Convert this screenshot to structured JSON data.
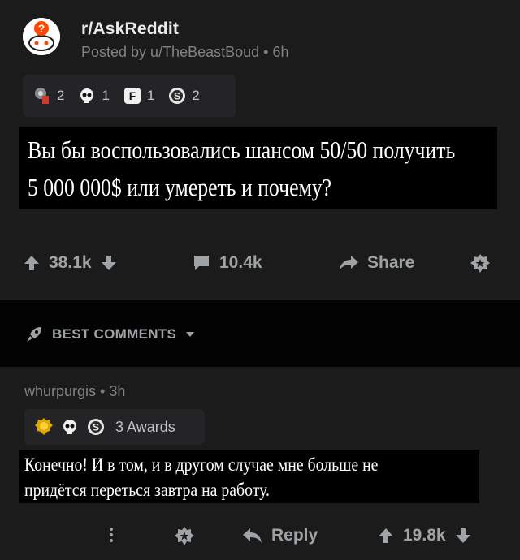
{
  "post": {
    "subreddit": "r/AskReddit",
    "meta": "Posted by u/TheBeastBoud • 6h",
    "awards": [
      {
        "icon": "gold-medal-icon",
        "count": "2"
      },
      {
        "icon": "skull-icon",
        "count": "1"
      },
      {
        "icon": "f-key-icon",
        "count": "1"
      },
      {
        "icon": "silver-coin-icon",
        "count": "2"
      }
    ],
    "title_line1": "Вы бы воспользовались шансом 50/50 получить",
    "title_line2": "5 000 000$ или умереть и почему?",
    "score": "38.1k",
    "comments": "10.4k",
    "share": "Share"
  },
  "sort": {
    "label": "BEST COMMENTS"
  },
  "comment": {
    "meta": "whurpurgis • 3h",
    "awards_label": "3 Awards",
    "text_line1": "Конечно! И в том, и в другом случае мне больше не",
    "text_line2": "придётся переться завтра на работу.",
    "reply": "Reply",
    "score": "19.8k"
  },
  "colors": {
    "background": "#1b1b1c",
    "text": "#d7dadc",
    "muted": "#818384",
    "bar": "#030303"
  }
}
